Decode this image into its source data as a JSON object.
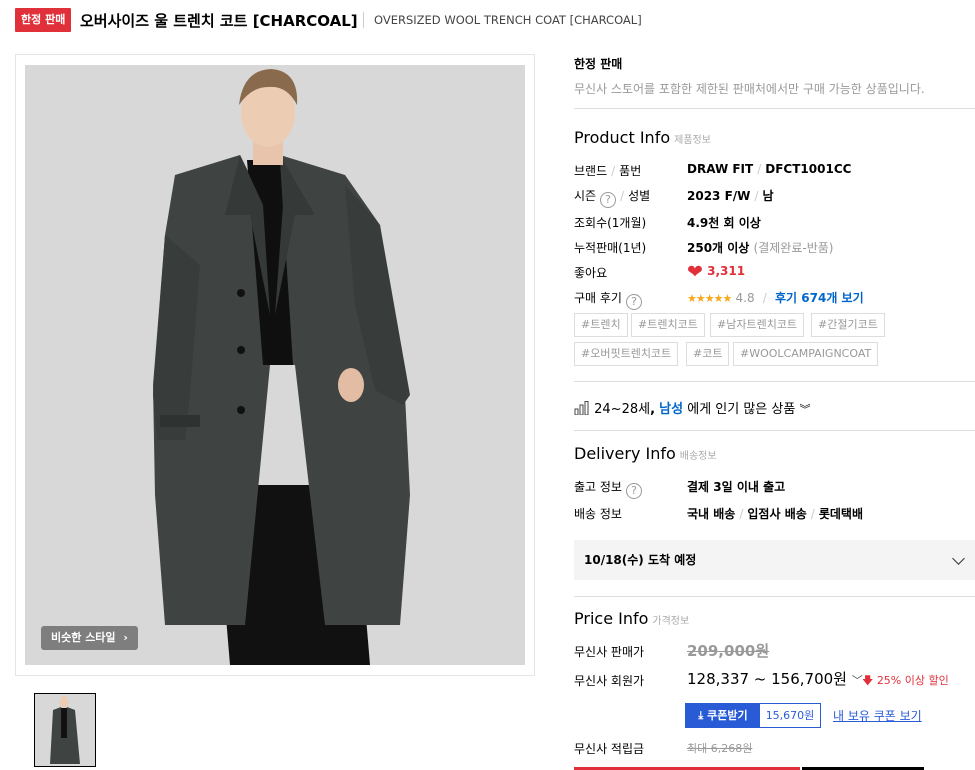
{
  "header": {
    "badge": "한정 판매",
    "title_kr": "오버사이즈 울 트렌치 코트 [CHARCOAL]",
    "title_en": "OVERSIZED WOOL TRENCH COAT [CHARCOAL]"
  },
  "gallery": {
    "similar_button": "비슷한 스타일"
  },
  "limited": {
    "title": "한정 판매",
    "desc": "무신사 스토어를 포함한 제한된 판매처에서만 구매 가능한 상품입니다."
  },
  "product_info": {
    "title": "Product Info",
    "sub": "제품정보",
    "brand_label_a": "브랜드",
    "brand_label_b": "품번",
    "brand_value": "DRAW FIT",
    "code_value": "DFCT1001CC",
    "season_label": "시즌",
    "gender_label": "성별",
    "season_value": "2023 F/W",
    "gender_value": "남",
    "views_label": "조회수(1개월)",
    "views_value": "4.9천 회 이상",
    "sales_label": "누적판매(1년)",
    "sales_value": "250개 이상",
    "sales_note": "(결제완료-반품)",
    "likes_label": "좋아요",
    "likes_value": "3,311",
    "review_label": "구매 후기",
    "stars": "★★★★★",
    "rating": "4.8",
    "review_link": "후기 674개 보기"
  },
  "tags": [
    "#트렌치",
    "#트렌치코트",
    "#남자트렌치코트",
    "#간절기코트",
    "#오버핏트렌치코트",
    "#코트",
    "#WOOLCAMPAIGNCOAT"
  ],
  "popular": {
    "age": "24~28세",
    "sep": ",",
    "gender": "남성",
    "suffix": "에게 인기 많은 상품"
  },
  "delivery_info": {
    "title": "Delivery Info",
    "sub": "배송정보",
    "ship_label": "출고 정보",
    "ship_value": "결제 3일 이내 출고",
    "method_label": "배송 정보",
    "method_a": "국내 배송",
    "method_b": "입점사 배송",
    "method_c": "롯데택배",
    "arrival": "10/18(수) 도착 예정"
  },
  "price_info": {
    "title": "Price Info",
    "sub": "가격정보",
    "sale_label": "무신사 판매가",
    "sale_value": "209,000원",
    "member_label": "무신사 회원가",
    "member_value": "128,337 ~ 156,700원",
    "discount": "25% 이상 할인",
    "coupon_label": "쿠폰받기",
    "coupon_value": "15,670원",
    "my_coupon": "내 보유 쿠폰 보기",
    "points_label": "무신사 적립금",
    "points_value": "최대 6,268원"
  },
  "colors": {
    "accent_red": "#e0303a",
    "link_blue": "#0066cc",
    "coupon_blue": "#2a5bd7",
    "coat": "#3f4443"
  }
}
